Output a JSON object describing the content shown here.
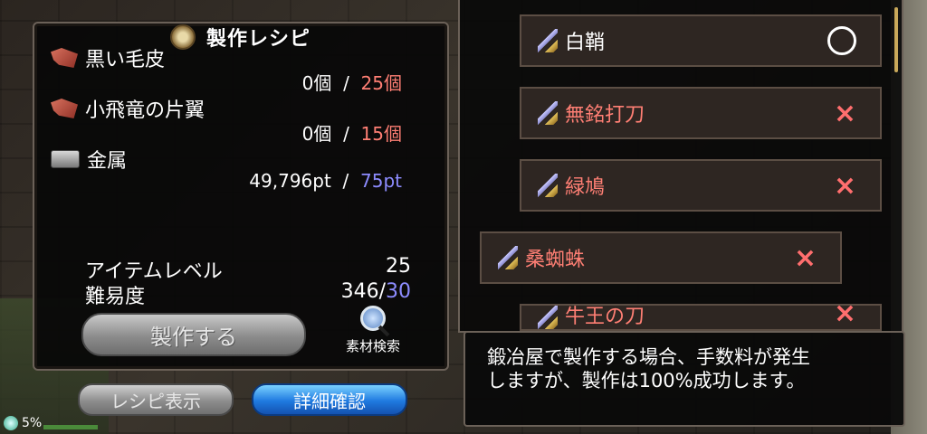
{
  "header": {
    "title": "製作レシピ",
    "title_icon": "scroll-icon"
  },
  "materials": [
    {
      "name": "黒い毛皮",
      "icon": "pelt-icon",
      "owned": "0個",
      "sep": "/",
      "required": "25個",
      "required_color": "#ff7f74"
    },
    {
      "name": "小飛竜の片翼",
      "icon": "wing-icon",
      "owned": "0個",
      "sep": "/",
      "required": "15個",
      "required_color": "#ff7f74"
    },
    {
      "name": "金属",
      "icon": "ingot-icon",
      "owned": "49,796pt",
      "sep": "/",
      "required": "75pt",
      "required_color": "#8d8cff"
    }
  ],
  "stats": {
    "item_level_label": "アイテムレベル",
    "item_level_value": "25",
    "difficulty_label": "難易度",
    "difficulty_value": "346",
    "difficulty_sep": "/",
    "difficulty_max": "30"
  },
  "buttons": {
    "craft": "製作する",
    "material_search": "素材検索",
    "recipe_display": "レシピ表示",
    "detail_confirm": "詳細確認"
  },
  "status": {
    "percent": "5%"
  },
  "recipe_list": [
    {
      "name": "白鞘",
      "mark": "○",
      "craftable": true
    },
    {
      "name": "無銘打刀",
      "mark": "×",
      "craftable": false
    },
    {
      "name": "緑鳩",
      "mark": "×",
      "craftable": false
    },
    {
      "name": "桑蜘蛛",
      "mark": "×",
      "craftable": false,
      "selected": true
    },
    {
      "name": "牛王の刀",
      "mark": "×",
      "craftable": false
    }
  ],
  "info": {
    "line1": "鍛冶屋で製作する場合、手数料が発生",
    "line2": "しますが、製作は100%成功します。"
  },
  "colors": {
    "accent_blue": "#1f7ae0",
    "insufficient": "#ff7f74",
    "ng_mark": "#ff6e6e"
  }
}
